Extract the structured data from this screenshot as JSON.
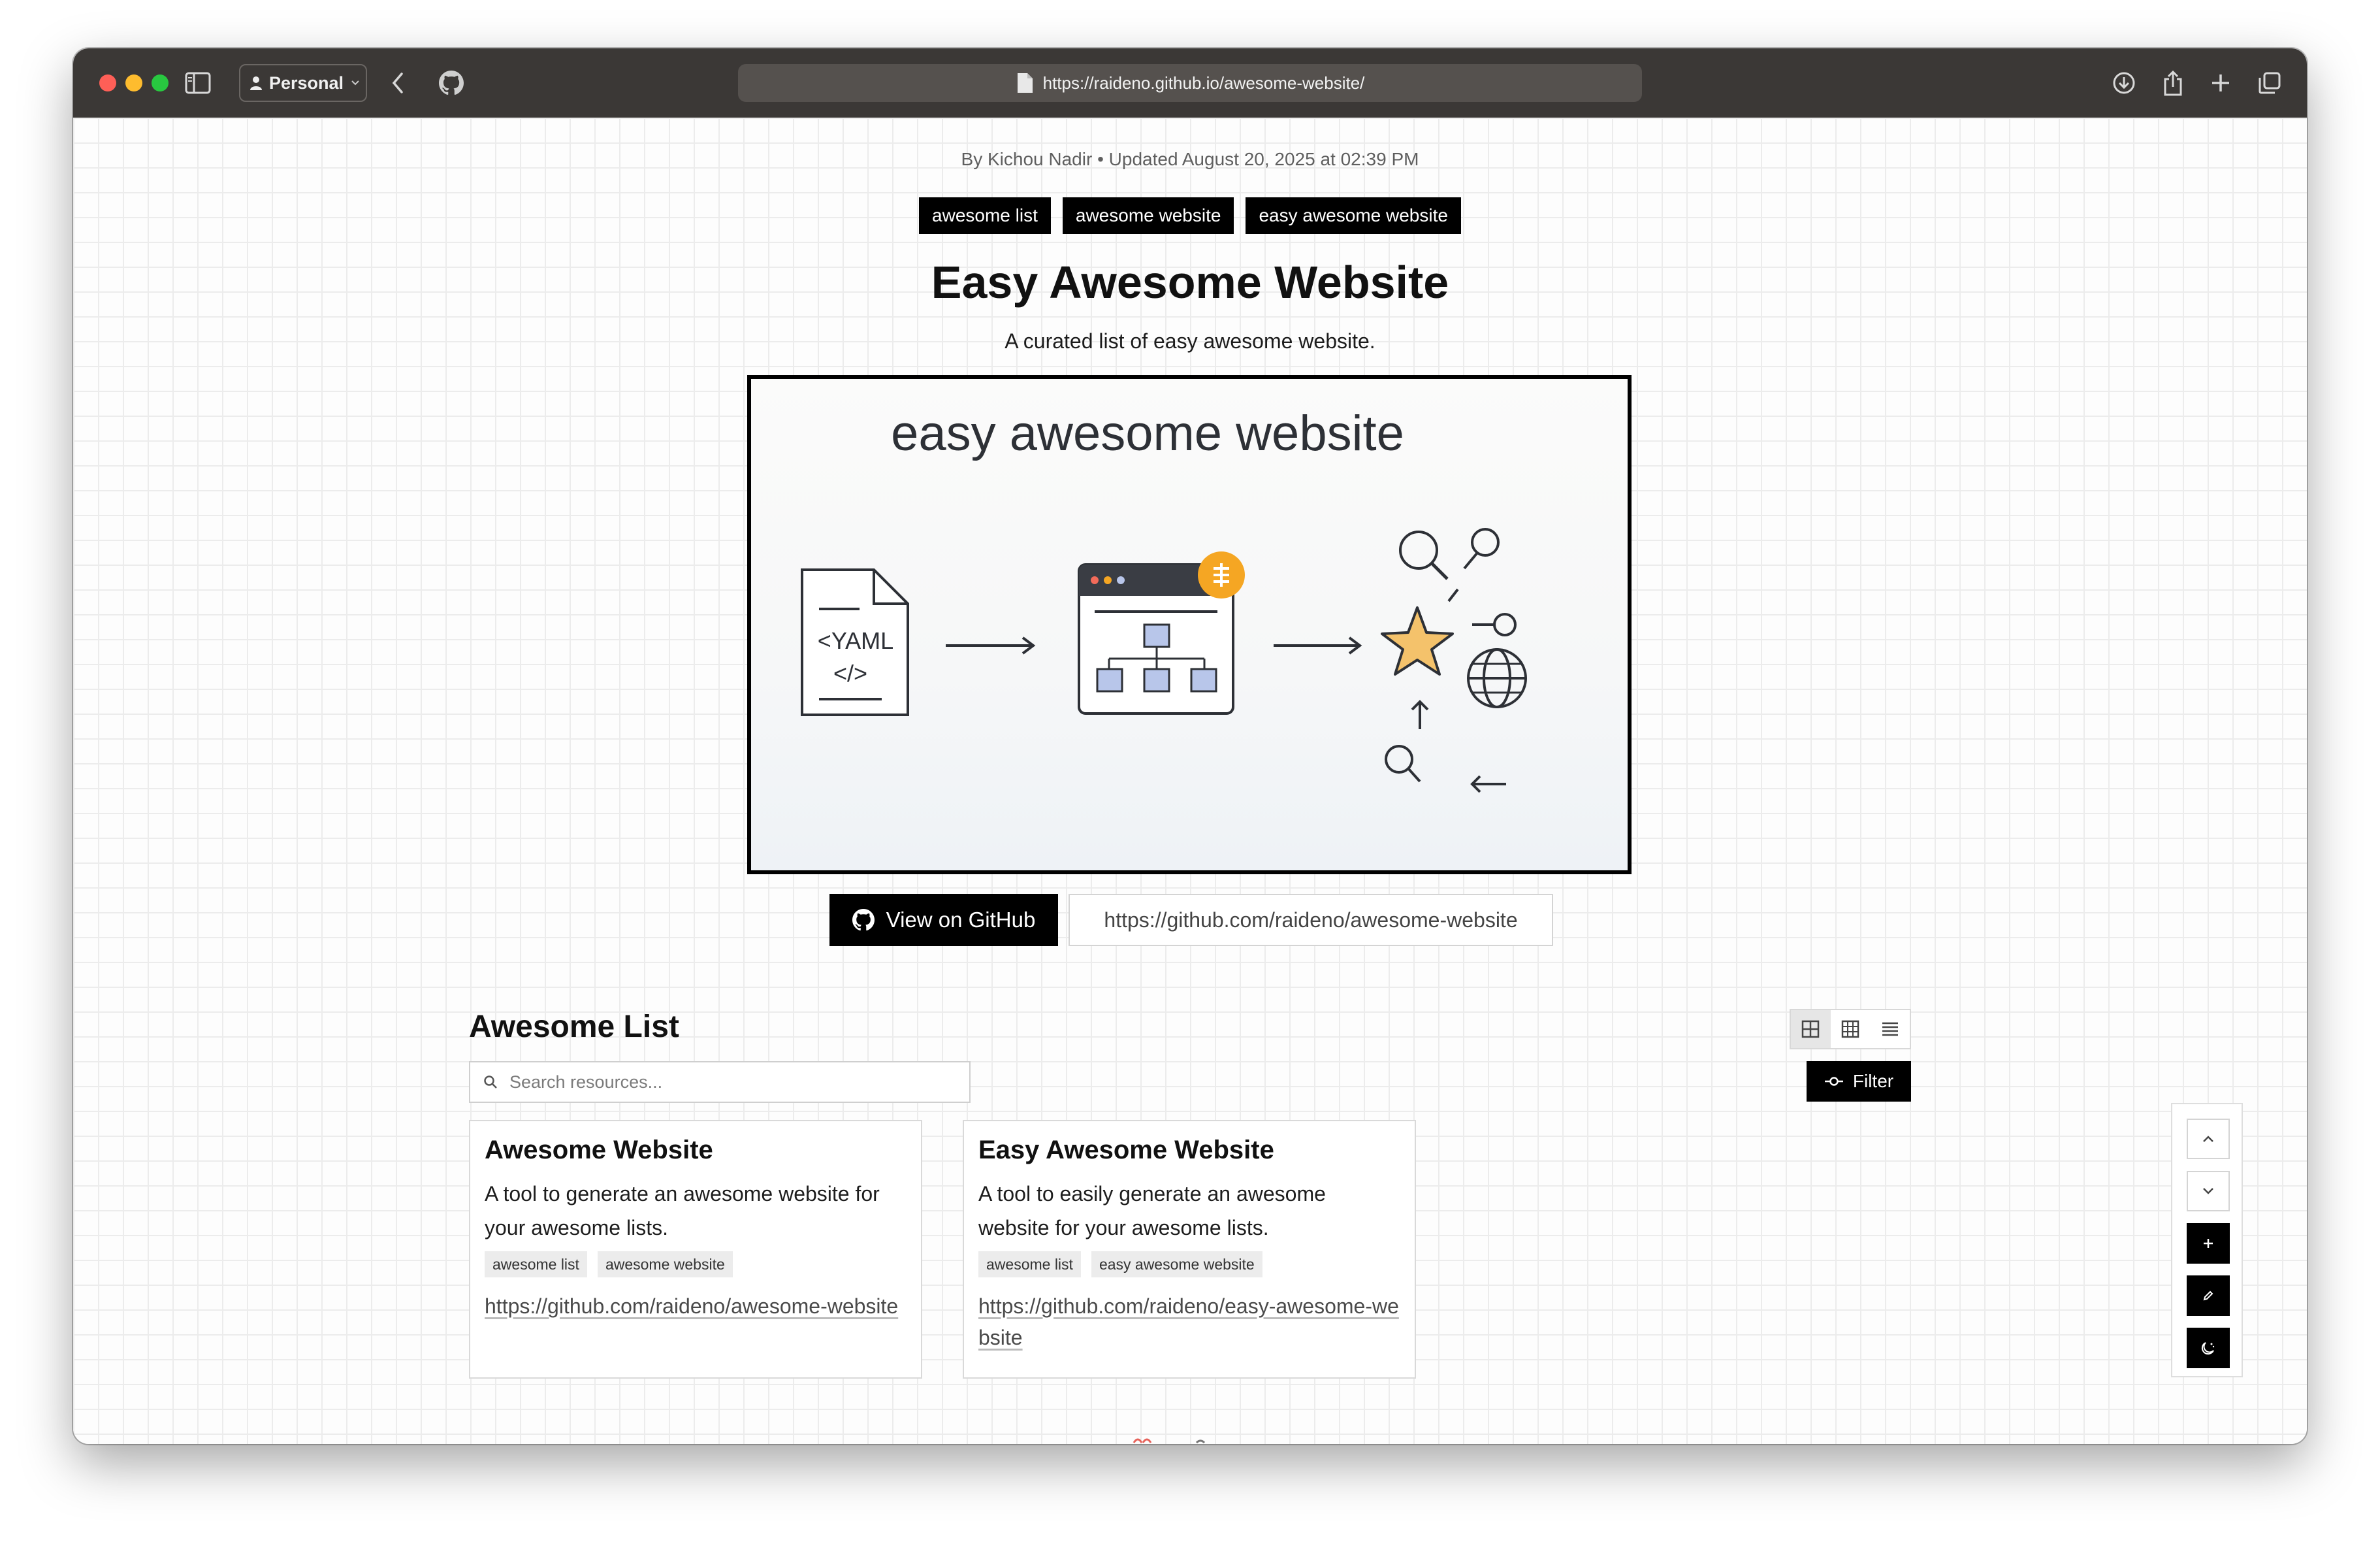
{
  "browser": {
    "profile_label": "Personal",
    "url": "https://raideno.github.io/awesome-website/"
  },
  "page": {
    "byline": "By Kichou Nadir • Updated August 20, 2025 at 02:39 PM",
    "tags": [
      "awesome list",
      "awesome website",
      "easy awesome website"
    ],
    "title": "Easy Awesome Website",
    "subtitle": "A curated list of easy awesome website.",
    "hero": {
      "title": "easy awesome website",
      "file_label_line1": "<YAML",
      "file_label_line2": "</>"
    },
    "github_button_label": "View on GitHub",
    "github_url": "https://github.com/raideno/awesome-website"
  },
  "list": {
    "heading": "Awesome List",
    "search_placeholder": "Search resources...",
    "filter_label": "Filter",
    "items": [
      {
        "title": "Awesome Website",
        "description": "A tool to generate an awesome website for your awesome lists.",
        "tags": [
          "awesome list",
          "awesome website"
        ],
        "url": "https://github.com/raideno/awesome-website"
      },
      {
        "title": "Easy Awesome Website",
        "description": "A tool to easily generate an awesome website for your awesome lists.",
        "tags": [
          "awesome list",
          "easy awesome website"
        ],
        "url": "https://github.com/raideno/easy-awesome-website"
      }
    ]
  },
  "icons": {
    "sidebar": "sidebar-icon",
    "back": "chevron-left-icon",
    "github": "github-icon",
    "download": "download-icon",
    "share": "share-icon",
    "new_tab": "plus-icon",
    "tabs": "tabs-overview-icon",
    "search": "search-icon",
    "filter": "filter-icon",
    "scroll_up": "chevron-up-icon",
    "scroll_down": "chevron-down-icon",
    "add": "plus-icon",
    "edit": "pencil-icon",
    "theme": "theme-toggle-icon"
  },
  "colors": {
    "titlebar": "#3b3836",
    "accent_dark": "#000000",
    "hero_star": "#f4c26b",
    "hero_badge": "#f5a623",
    "hero_box_fill": "#b8c6ea"
  }
}
